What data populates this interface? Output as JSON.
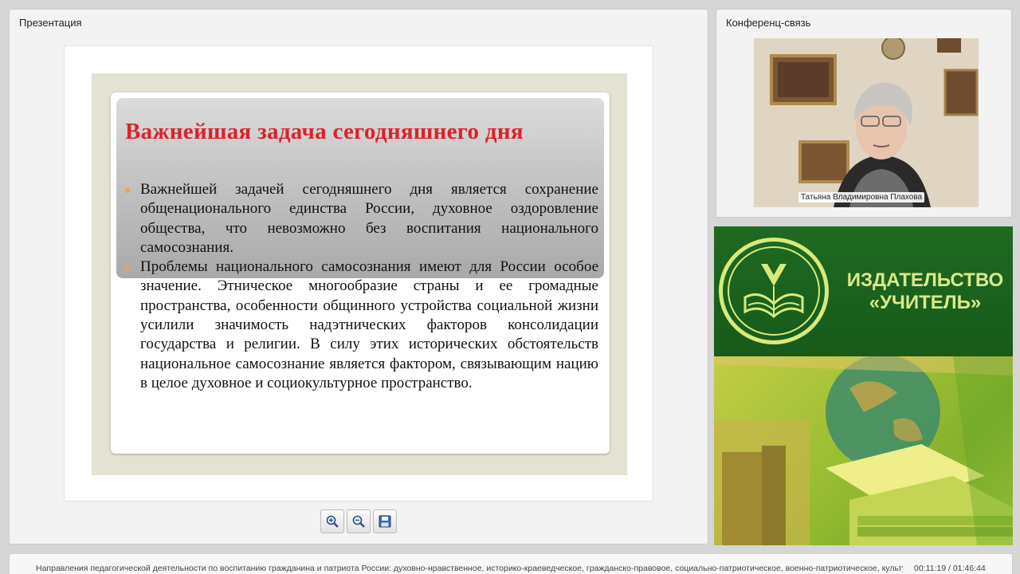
{
  "presentation": {
    "title": "Презентация",
    "slide": {
      "heading": "Важнейшая задача сегодняшнего дня",
      "bullets": [
        "Важнейшей задачей сегодняшнего дня является сохранение общенационального единства России, духовное оздоровление общества, что невозможно без воспитания национального самосознания.",
        "Проблемы национального самосознания имеют для России особое значение. Этническое многообразие страны и ее громадные пространства, особенности общинного устройства социальной жизни усилили значимость надэтнических факторов консолидации государства и религии. В силу этих исторических обстоятельств национальное самосознание является фактором, связывающим нацию в целое духовное и социокультурное пространство."
      ],
      "colors": {
        "heading": "#e0202a",
        "bullet": "#f4a23c",
        "card_bg": "#e3e2d3"
      }
    },
    "toolbar": [
      "zoom-in-icon",
      "zoom-out-icon",
      "save-icon"
    ]
  },
  "conference": {
    "title": "Конференц-связь",
    "speaker_name": "Татьяна Владимировна Плахова"
  },
  "banner": {
    "line1": "ИЗДАТЕЛЬСТВО",
    "line2": "«УЧИТЕЛЬ»",
    "colors": {
      "green": "#1f6a22",
      "text": "#dbe98a"
    }
  },
  "footer": {
    "description": "Направления педагогической деятельности по воспитанию гражданина и патриота России: духовно-нравственное, историко-краеведческое, гражданско-правовое, социально-патриотическое, военно-патриотическое, культур",
    "time": "00:11:19 / 01:46:44"
  }
}
